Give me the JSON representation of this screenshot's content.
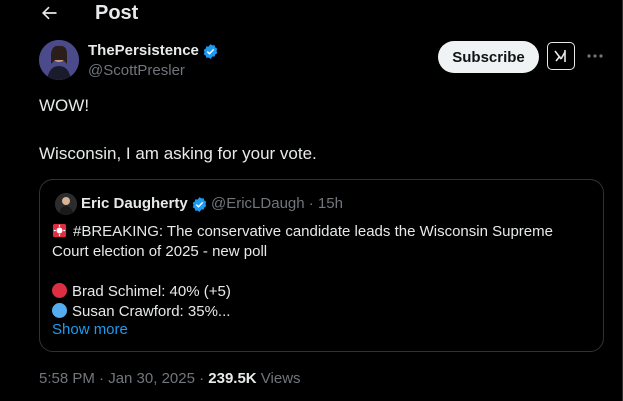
{
  "header": {
    "title": "Post"
  },
  "author": {
    "display_name": "ThePersistence",
    "handle": "@ScottPresler"
  },
  "actions": {
    "subscribe_label": "Subscribe"
  },
  "post": {
    "line1": "WOW!",
    "line2": "Wisconsin, I am asking for your vote."
  },
  "quote": {
    "display_name": "Eric Daugherty",
    "handle_time": "@EricLDaugh · 15h",
    "line1": "#BREAKING: The conservative candidate leads the Wisconsin Supreme",
    "line2": "Court election of 2025 - new poll",
    "item1": "Brad Schimel: 40% (+5)",
    "item2": "Susan Crawford: 35%...",
    "show_more": "Show more"
  },
  "meta": {
    "time_date": "5:58 PM · Jan 30, 2025 · ",
    "views_count": "239.5K",
    "views_label": " Views"
  },
  "colors": {
    "background": "#000000",
    "text": "#e7e9ea",
    "muted": "#71767b",
    "link": "#1d9bf0",
    "verified": "#1d9bf0",
    "red_dot": "#dd2e44",
    "blue_dot": "#55acee"
  }
}
